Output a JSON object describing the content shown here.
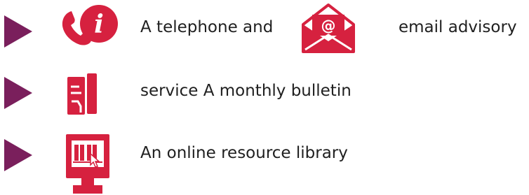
{
  "items": [
    {
      "text": "A telephone and",
      "icon": "phone-info-icon"
    },
    {
      "text": "email advisory",
      "icon": "email-at-icon"
    },
    {
      "text": "service A monthly bulletin",
      "icon": "bulletin-document-icon"
    },
    {
      "text": "An online resource library",
      "icon": "monitor-library-icon"
    }
  ],
  "colors": {
    "bullet": "#7a1f5c",
    "icon": "#d6213f",
    "text": "#1f1f1f"
  }
}
